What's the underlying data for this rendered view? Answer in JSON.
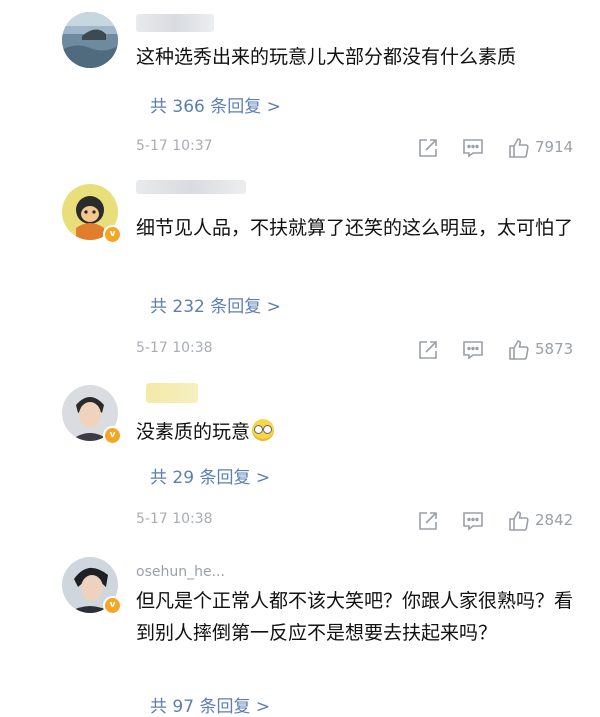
{
  "comments": [
    {
      "content": "这种选秀出来的玩意儿大部分都没有什么素质",
      "replies": "共 366 条回复 >",
      "time": "5-17 10:37",
      "likes": "7914",
      "verified": false
    },
    {
      "content": "细节见人品，不扶就算了还笑的这么明显，太可怕了",
      "replies": "共 232 条回复 >",
      "time": "5-17 10:38",
      "likes": "5873",
      "verified": true
    },
    {
      "content": "没素质的玩意",
      "replies": "共 29 条回复 >",
      "time": "5-17 10:38",
      "likes": "2842",
      "verified": true
    },
    {
      "username": "osehun_he...",
      "content": "但凡是个正常人都不该大笑吧？你跟人家很熟吗？看到别人摔倒第一反应不是想要去扶起来吗？",
      "replies": "共 97 条回复 >",
      "verified": true
    }
  ],
  "icons": {
    "share": "share-icon",
    "reply": "comment-icon",
    "like": "thumbs-up-icon",
    "emoji": "rolling-eyes-emoji"
  },
  "colors": {
    "link": "#5b7fb5",
    "muted": "#a8adb3",
    "verified_badge": "#f5a623"
  }
}
